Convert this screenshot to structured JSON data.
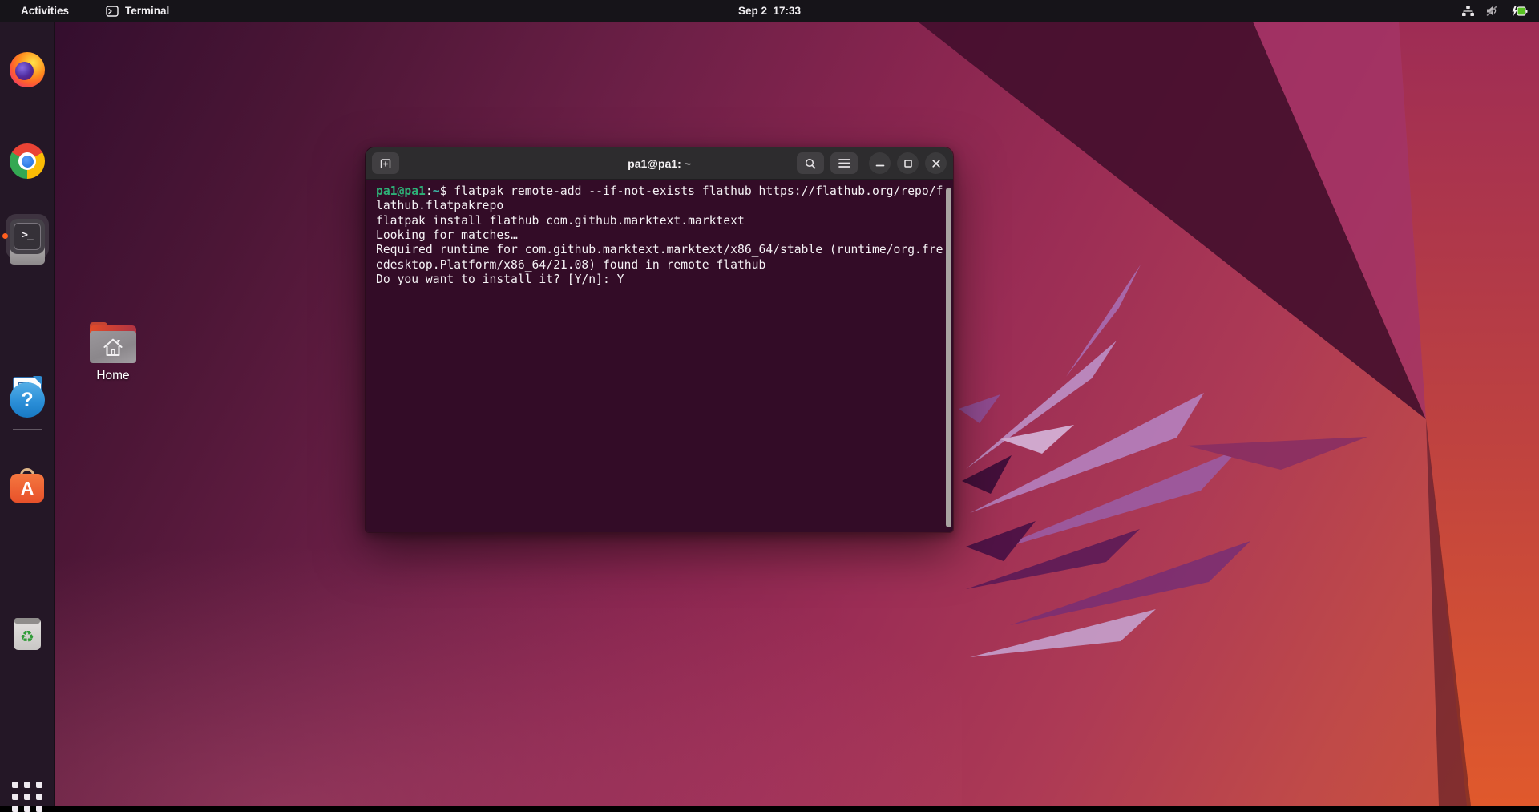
{
  "top_bar": {
    "activities_label": "Activities",
    "focused_app": {
      "label": "Terminal",
      "icon": "terminal-icon"
    },
    "clock": "Sep 2  17:33",
    "tray_icons": [
      "network-wired-icon",
      "volume-muted-icon",
      "battery-charging-icon"
    ]
  },
  "dock": {
    "items": [
      {
        "id": "firefox",
        "icon": "firefox-icon",
        "running": false
      },
      {
        "id": "chrome",
        "icon": "chrome-icon",
        "running": false
      },
      {
        "id": "files",
        "icon": "files-icon",
        "running": false
      },
      {
        "id": "terminal",
        "icon": "terminal-icon",
        "running": true,
        "focused": true
      },
      {
        "id": "libreoffice-writer",
        "icon": "libreoffice-writer-icon",
        "running": false
      },
      {
        "id": "ubuntu-software",
        "icon": "ubuntu-software-icon",
        "running": false
      },
      {
        "id": "help",
        "icon": "help-icon",
        "running": false
      },
      {
        "id": "trash",
        "icon": "trash-icon",
        "running": false
      }
    ],
    "show_apps_icon": "show-applications-icon",
    "terminal_glyph": ">_",
    "software_glyph": "A",
    "help_glyph": "?",
    "recycle_glyph": "♻"
  },
  "desktop": {
    "home_label": "Home"
  },
  "terminal_window": {
    "title": "pa1@pa1: ~",
    "buttons": {
      "new_tab": "new-tab-icon",
      "search": "search-icon",
      "menu": "hamburger-menu-icon",
      "minimize": "minimize-icon",
      "maximize": "maximize-icon",
      "close": "close-icon"
    },
    "colors": {
      "background": "#330c27",
      "header": "#2d2c2e",
      "prompt_user_green": "#2eb077",
      "prompt_path_teal": "#3cb3a2",
      "text": "#f5f2f5"
    },
    "lines": [
      {
        "segments": [
          {
            "style": "user",
            "text": "pa1@pa1"
          },
          {
            "style": "plain",
            "text": ":"
          },
          {
            "style": "path",
            "text": "~"
          },
          {
            "style": "plain",
            "text": "$ flatpak remote-add --if-not-exists flathub https://flathub.org/repo/f"
          }
        ]
      },
      {
        "segments": [
          {
            "style": "plain",
            "text": "lathub.flatpakrepo"
          }
        ]
      },
      {
        "segments": [
          {
            "style": "plain",
            "text": "flatpak install flathub com.github.marktext.marktext"
          }
        ]
      },
      {
        "segments": [
          {
            "style": "plain",
            "text": "Looking for matches…"
          }
        ]
      },
      {
        "segments": [
          {
            "style": "plain",
            "text": "Required runtime for com.github.marktext.marktext/x86_64/stable (runtime/org.fre"
          }
        ]
      },
      {
        "segments": [
          {
            "style": "plain",
            "text": "edesktop.Platform/x86_64/21.08) found in remote flathub"
          }
        ]
      },
      {
        "segments": [
          {
            "style": "plain",
            "text": "Do you want to install it? [Y/n]: Y"
          }
        ]
      }
    ]
  }
}
